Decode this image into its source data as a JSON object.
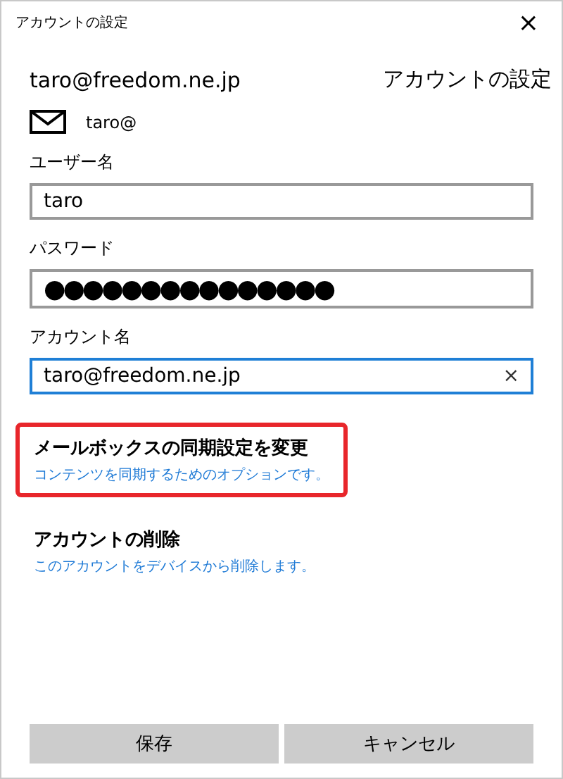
{
  "window": {
    "title": "アカウントの設定",
    "close": "×"
  },
  "header": {
    "email": "taro@freedom.ne.jp",
    "heading": "アカウントの設定"
  },
  "account": {
    "address": "taro@"
  },
  "fields": [
    {
      "label": "ユーザー名",
      "value": "taro",
      "focused": false
    },
    {
      "label": "パスワード",
      "value": "●●●●●●●●●●●●●●●",
      "focused": false
    },
    {
      "label": "アカウント名",
      "value": "taro@freedom.ne.jp",
      "focused": true,
      "clear": "×"
    }
  ],
  "options": [
    {
      "title": "メールボックスの同期設定を変更",
      "description": "コンテンツを同期するためのオプションです。",
      "highlighted": true
    },
    {
      "title": "アカウントの削除",
      "description": "このアカウントをデバイスから削除します。",
      "highlighted": false
    }
  ],
  "buttons": [
    "保存",
    "キャンセル"
  ]
}
